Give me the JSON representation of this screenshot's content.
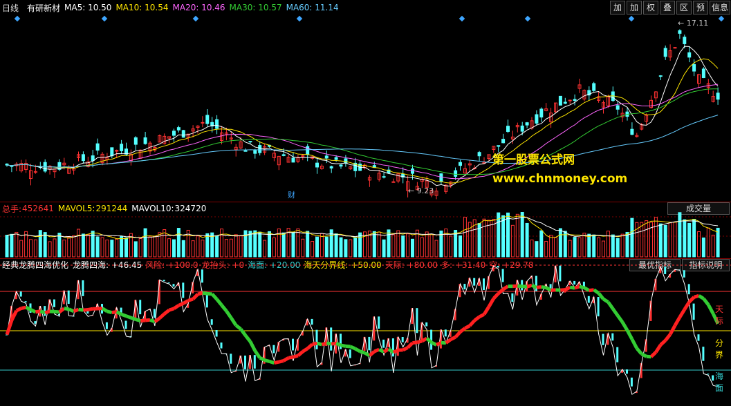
{
  "header": {
    "period": "日线",
    "stock_name": "有研新材",
    "ma": [
      {
        "label": "MA5:",
        "value": "10.50",
        "color": "#ffffff"
      },
      {
        "label": "MA10:",
        "value": "10.54",
        "color": "#ffe600"
      },
      {
        "label": "MA20:",
        "value": "10.46",
        "color": "#ff66ff"
      },
      {
        "label": "MA30:",
        "value": "10.57",
        "color": "#33cc33"
      },
      {
        "label": "MA60:",
        "value": "11.14",
        "color": "#66ccff"
      }
    ]
  },
  "toolbar": [
    "加",
    "加",
    "权",
    "叠",
    "区",
    "预",
    "信息"
  ],
  "price_panel": {
    "high_label": "17.11",
    "low_label": "9.23",
    "finance_marker": "财",
    "watermark_title": "第一股票公式网",
    "watermark_url": "www.chnmoney.com"
  },
  "volume_panel": {
    "total_label": "总手:",
    "total_value": "452641",
    "mavol5_label": "MAVOL5:",
    "mavol5_value": "291244",
    "mavol10_label": "MAVOL10:",
    "mavol10_value": "324720",
    "tab_label": "成交量"
  },
  "indicator_panel": {
    "name": "经典龙腾四海优化",
    "items": [
      {
        "label": "龙腾四海:",
        "value": "+46.45",
        "color": "#ffffff"
      },
      {
        "label": "风险:",
        "value": "+100.0",
        "color": "#ff3333"
      },
      {
        "label": "龙抬头:",
        "value": "+0",
        "color": "#ff3333"
      },
      {
        "label": "海面:",
        "value": "+20.00",
        "color": "#33cccc"
      },
      {
        "label": "海天分界线:",
        "value": "+50.00",
        "color": "#ffe600"
      },
      {
        "label": "天际:",
        "value": "+80.00",
        "color": "#ff3333"
      },
      {
        "label": "多:",
        "value": "+31.40",
        "color": "#ff3333"
      },
      {
        "label": "空:",
        "value": "+29.78",
        "color": "#ff3333"
      }
    ],
    "tab_best": "最优指标",
    "tab_help": "指标说明",
    "right_labels": {
      "sky": "天际",
      "boundary": "分界",
      "sea": "海面"
    }
  },
  "colors": {
    "up": "#ff3232",
    "down": "#54ffff",
    "bg": "#000000"
  }
}
